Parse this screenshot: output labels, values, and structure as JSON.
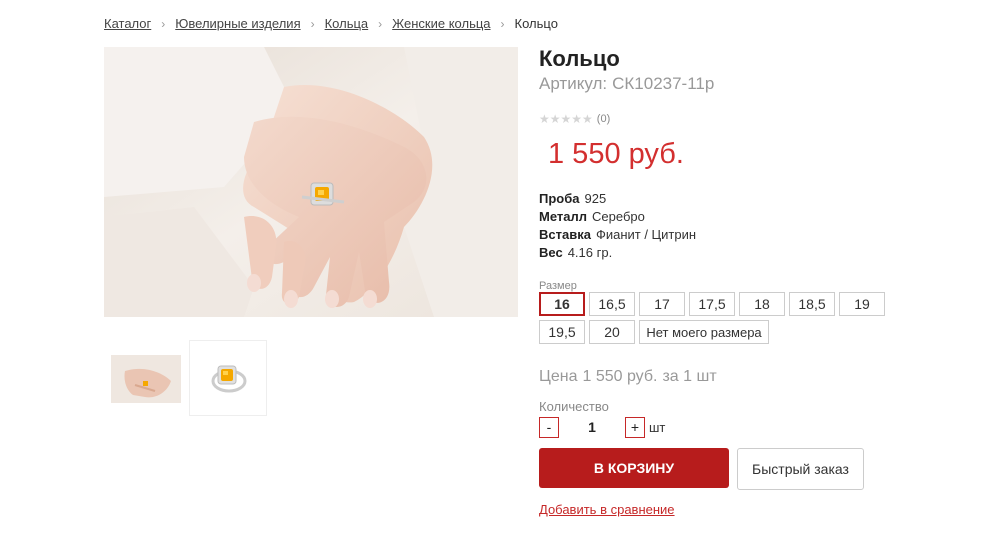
{
  "breadcrumb": {
    "items": [
      "Каталог",
      "Ювелирные изделия",
      "Кольца",
      "Женские кольца"
    ],
    "current": "Кольцо",
    "separator": "›"
  },
  "product": {
    "title": "Кольцо",
    "sku_label": "Артикул:",
    "sku": "СК10237-11р",
    "rating_stars": "★★★★★",
    "rating_count": "(0)",
    "price_value": "1 550",
    "price_currency": "руб."
  },
  "specs": [
    {
      "key": "Проба",
      "value": "925"
    },
    {
      "key": "Металл",
      "value": "Серебро"
    },
    {
      "key": "Вставка",
      "value": "Фианит / Цитрин"
    },
    {
      "key": "Вес",
      "value": "4.16 гр."
    }
  ],
  "sizes": {
    "label": "Размер",
    "selected": "16",
    "options": [
      "16",
      "16,5",
      "17",
      "17,5",
      "18",
      "18,5",
      "19",
      "19,5",
      "20"
    ],
    "no_size": "Нет моего размера"
  },
  "unit_price": {
    "label": "Цена",
    "value": "1 550 руб.",
    "suffix": "за 1 шт"
  },
  "quantity": {
    "label": "Количество",
    "minus": "-",
    "plus": "+",
    "value": "1",
    "unit": "шт"
  },
  "actions": {
    "add_to_cart": "В КОРЗИНУ",
    "quick_order": "Быстрый заказ",
    "compare": "Добавить в сравнение"
  },
  "colors": {
    "accent": "#b71c1c",
    "price": "#d32f2f",
    "gem": "#f5a800"
  },
  "icons": [
    "ring-photo",
    "ring-thumbnail"
  ]
}
